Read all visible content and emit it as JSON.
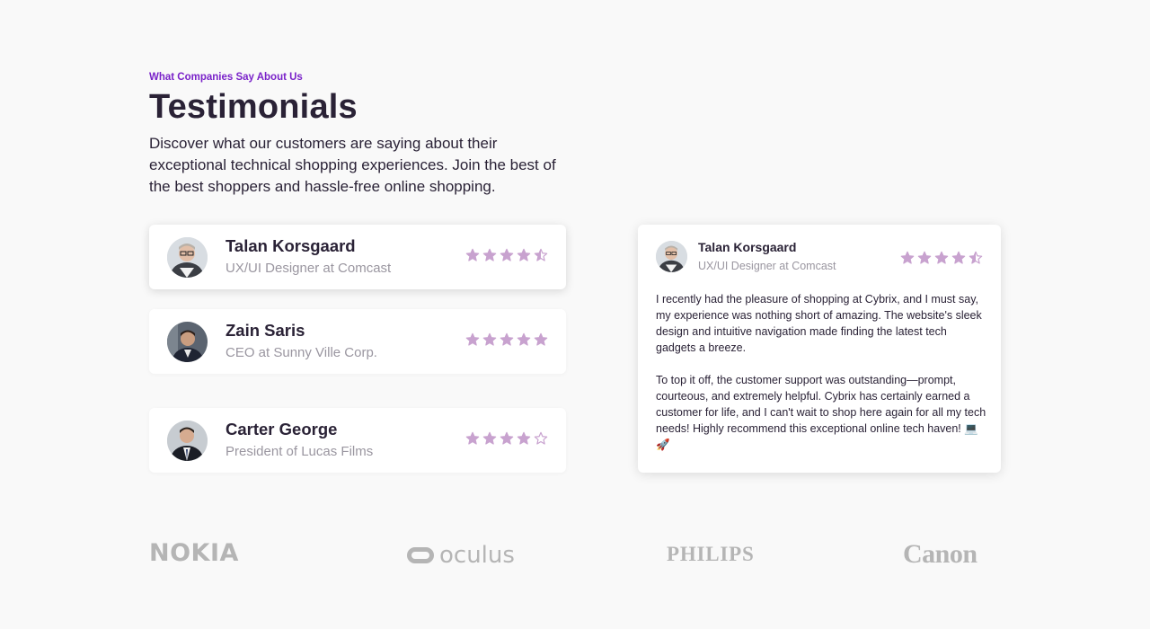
{
  "header": {
    "eyebrow": "What Companies Say About Us",
    "title": "Testimonials",
    "intro": "Discover what our customers are saying about their exceptional technical shopping experiences. Join the best of the best shoppers and hassle-free online shopping."
  },
  "colors": {
    "accent": "#7a22c9",
    "star": "#c8a2cf",
    "heading": "#2a2236",
    "muted": "#9a96a0",
    "logo": "#b5b5b5"
  },
  "testimonials": [
    {
      "name": "Talan Korsgaard",
      "role": "UX/UI Designer at Comcast",
      "rating": 4.5,
      "icon": "person-glasses-avatar"
    },
    {
      "name": "Zain Saris",
      "role": "CEO at Sunny Ville Corp.",
      "rating": 5,
      "icon": "person-suit-avatar"
    },
    {
      "name": "Carter George",
      "role": "President of Lucas Films",
      "rating": 4,
      "icon": "person-suit-tie-avatar"
    }
  ],
  "selected": {
    "name": "Talan Korsgaard",
    "role": "UX/UI Designer at Comcast",
    "rating": 4.5,
    "paragraph1": "I recently had the pleasure of shopping at Cybrix, and I must say, my experience was nothing short of amazing. The website's sleek design and intuitive navigation made finding the latest tech gadgets a breeze.",
    "paragraph2": "To top it off, the customer support was outstanding—prompt, courteous, and extremely helpful. Cybrix has certainly earned a customer for life, and I can't wait to shop here again for all my tech needs! Highly recommend this exceptional online tech haven! 💻🚀"
  },
  "logos": {
    "nokia": "NOKIA",
    "oculus": "oculus",
    "philips": "PHILIPS",
    "canon": "Canon"
  }
}
